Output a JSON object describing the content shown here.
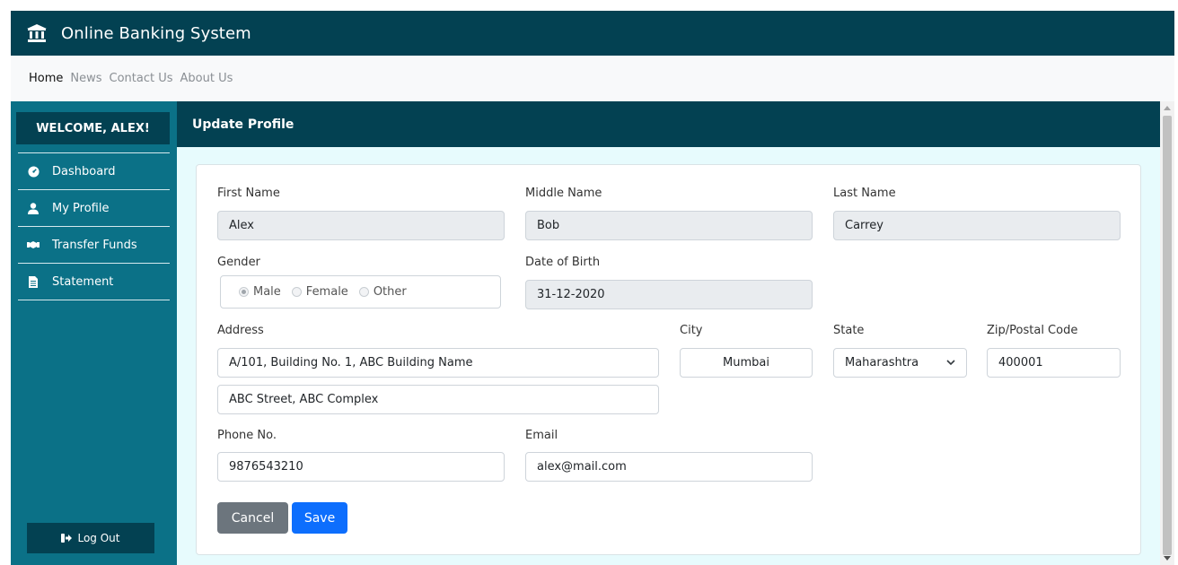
{
  "app": {
    "title": "Online Banking System",
    "brand_icon": "bank-building-icon",
    "brand_color": "#034152",
    "sidebar_color": "#0b7187"
  },
  "nav": {
    "items": [
      "Home",
      "News",
      "Contact Us",
      "About Us"
    ],
    "active": "Home"
  },
  "sidebar": {
    "welcome": "WELCOME, ALEX!",
    "items": [
      {
        "label": "Dashboard",
        "icon": "gauge-icon"
      },
      {
        "label": "My Profile",
        "icon": "user-icon"
      },
      {
        "label": "Transfer Funds",
        "icon": "handshake-icon"
      },
      {
        "label": "Statement",
        "icon": "document-icon"
      }
    ],
    "logout": {
      "label": "Log Out",
      "icon": "sign-out-icon"
    }
  },
  "main": {
    "title": "Update Profile"
  },
  "form": {
    "first_name": {
      "label": "First Name",
      "value": "Alex"
    },
    "middle_name": {
      "label": "Middle Name",
      "value": "Bob"
    },
    "last_name": {
      "label": "Last Name",
      "value": "Carrey"
    },
    "gender": {
      "label": "Gender",
      "options": [
        "Male",
        "Female",
        "Other"
      ],
      "selected": "Male"
    },
    "dob": {
      "label": "Date of Birth",
      "value": "31-12-2020"
    },
    "address": {
      "label": "Address",
      "line1": "A/101, Building No. 1, ABC Building Name",
      "line2": "ABC Street, ABC Complex"
    },
    "city": {
      "label": "City",
      "value": "Mumbai"
    },
    "state": {
      "label": "State",
      "value": "Maharashtra"
    },
    "zip": {
      "label": "Zip/Postal Code",
      "value": "400001"
    },
    "phone": {
      "label": "Phone No.",
      "value": "9876543210"
    },
    "email": {
      "label": "Email",
      "value": "alex@mail.com"
    },
    "cancel_label": "Cancel",
    "save_label": "Save"
  }
}
